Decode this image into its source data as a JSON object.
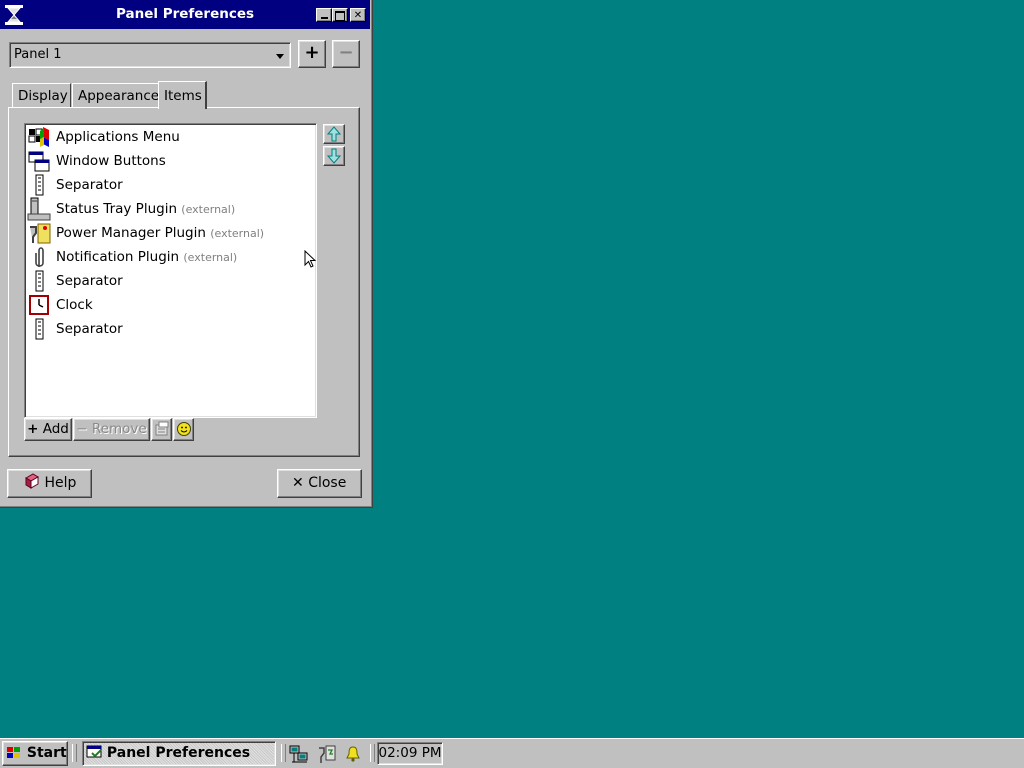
{
  "window": {
    "title": "Panel Preferences",
    "minimize_label": "–",
    "maximize_label": "□",
    "close_label": "✕"
  },
  "panel_selector": {
    "selected": "Panel 1",
    "add_label": "+",
    "remove_label": "−"
  },
  "tabs": [
    {
      "label": "Display",
      "active": false
    },
    {
      "label": "Appearance",
      "active": false
    },
    {
      "label": "Items",
      "active": true
    }
  ],
  "items": [
    {
      "label": "Applications Menu",
      "suffix": "",
      "icon": "applications-menu-icon"
    },
    {
      "label": "Window Buttons",
      "suffix": "",
      "icon": "window-buttons-icon"
    },
    {
      "label": "Separator",
      "suffix": "",
      "icon": "separator-icon"
    },
    {
      "label": "Status Tray Plugin",
      "suffix": "(external)",
      "icon": "status-tray-icon"
    },
    {
      "label": "Power Manager Plugin",
      "suffix": "(external)",
      "icon": "power-manager-icon"
    },
    {
      "label": "Notification Plugin",
      "suffix": "(external)",
      "icon": "notification-icon"
    },
    {
      "label": "Separator",
      "suffix": "",
      "icon": "separator-icon"
    },
    {
      "label": "Clock",
      "suffix": "",
      "icon": "clock-icon"
    },
    {
      "label": "Separator",
      "suffix": "",
      "icon": "separator-icon"
    }
  ],
  "list_buttons": {
    "add_label": "Add",
    "remove_label": "Remove"
  },
  "footer": {
    "help_label": "Help",
    "close_label": "Close"
  },
  "taskbar": {
    "start_label": "Start",
    "task_label": "Panel Preferences",
    "clock": "02:09 PM"
  },
  "colors": {
    "desktop": "#008080",
    "titlebar": "#000080",
    "face": "#c0c0c0"
  }
}
